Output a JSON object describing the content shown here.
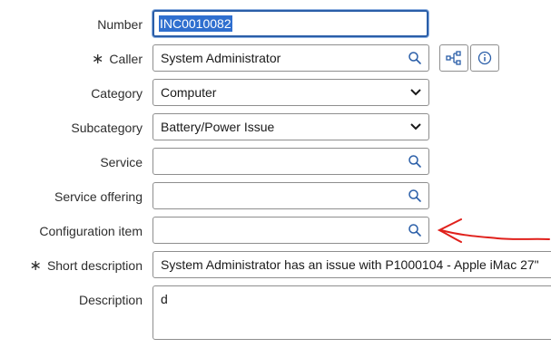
{
  "form": {
    "number": {
      "label": "Number",
      "value": "INC0010082"
    },
    "caller": {
      "required_mark": "∗",
      "label": "Caller",
      "value": "System Administrator"
    },
    "category": {
      "label": "Category",
      "value": "Computer"
    },
    "subcategory": {
      "label": "Subcategory",
      "value": "Battery/Power Issue"
    },
    "service": {
      "label": "Service",
      "value": ""
    },
    "service_offering": {
      "label": "Service offering",
      "value": ""
    },
    "configuration_item": {
      "label": "Configuration item",
      "value": ""
    },
    "short_description": {
      "required_mark": "∗",
      "label": "Short description",
      "value": "System Administrator has an issue with P1000104 - Apple iMac 27\""
    },
    "description": {
      "label": "Description",
      "value": "d"
    }
  },
  "icons": {
    "search": "search-icon",
    "hierarchy": "hierarchy-icon",
    "info": "info-icon",
    "chevron": "chevron-down-icon"
  },
  "colors": {
    "focus_border": "#2a5ea8",
    "selection": "#2f6fcf",
    "icon_blue": "#2a5ea8",
    "annotation": "#e0201b"
  }
}
